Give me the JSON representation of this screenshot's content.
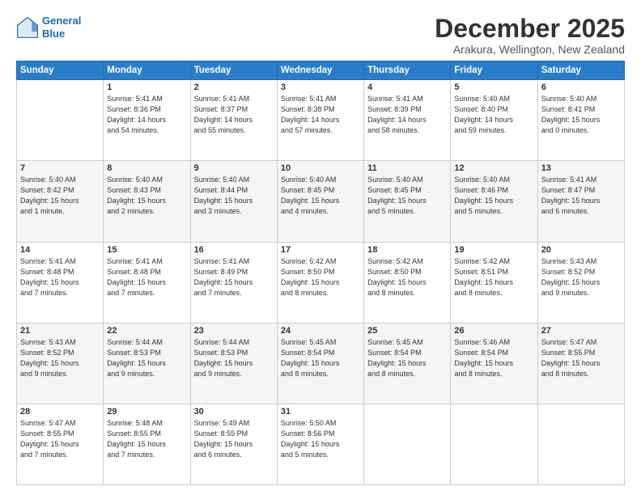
{
  "logo": {
    "line1": "General",
    "line2": "Blue"
  },
  "title": "December 2025",
  "subtitle": "Arakura, Wellington, New Zealand",
  "days_header": [
    "Sunday",
    "Monday",
    "Tuesday",
    "Wednesday",
    "Thursday",
    "Friday",
    "Saturday"
  ],
  "weeks": [
    [
      {
        "day": "",
        "info": ""
      },
      {
        "day": "1",
        "info": "Sunrise: 5:41 AM\nSunset: 8:36 PM\nDaylight: 14 hours\nand 54 minutes."
      },
      {
        "day": "2",
        "info": "Sunrise: 5:41 AM\nSunset: 8:37 PM\nDaylight: 14 hours\nand 55 minutes."
      },
      {
        "day": "3",
        "info": "Sunrise: 5:41 AM\nSunset: 8:38 PM\nDaylight: 14 hours\nand 57 minutes."
      },
      {
        "day": "4",
        "info": "Sunrise: 5:41 AM\nSunset: 8:39 PM\nDaylight: 14 hours\nand 58 minutes."
      },
      {
        "day": "5",
        "info": "Sunrise: 5:40 AM\nSunset: 8:40 PM\nDaylight: 14 hours\nand 59 minutes."
      },
      {
        "day": "6",
        "info": "Sunrise: 5:40 AM\nSunset: 8:41 PM\nDaylight: 15 hours\nand 0 minutes."
      }
    ],
    [
      {
        "day": "7",
        "info": "Sunrise: 5:40 AM\nSunset: 8:42 PM\nDaylight: 15 hours\nand 1 minute."
      },
      {
        "day": "8",
        "info": "Sunrise: 5:40 AM\nSunset: 8:43 PM\nDaylight: 15 hours\nand 2 minutes."
      },
      {
        "day": "9",
        "info": "Sunrise: 5:40 AM\nSunset: 8:44 PM\nDaylight: 15 hours\nand 3 minutes."
      },
      {
        "day": "10",
        "info": "Sunrise: 5:40 AM\nSunset: 8:45 PM\nDaylight: 15 hours\nand 4 minutes."
      },
      {
        "day": "11",
        "info": "Sunrise: 5:40 AM\nSunset: 8:45 PM\nDaylight: 15 hours\nand 5 minutes."
      },
      {
        "day": "12",
        "info": "Sunrise: 5:40 AM\nSunset: 8:46 PM\nDaylight: 15 hours\nand 5 minutes."
      },
      {
        "day": "13",
        "info": "Sunrise: 5:41 AM\nSunset: 8:47 PM\nDaylight: 15 hours\nand 6 minutes."
      }
    ],
    [
      {
        "day": "14",
        "info": "Sunrise: 5:41 AM\nSunset: 8:48 PM\nDaylight: 15 hours\nand 7 minutes."
      },
      {
        "day": "15",
        "info": "Sunrise: 5:41 AM\nSunset: 8:48 PM\nDaylight: 15 hours\nand 7 minutes."
      },
      {
        "day": "16",
        "info": "Sunrise: 5:41 AM\nSunset: 8:49 PM\nDaylight: 15 hours\nand 7 minutes."
      },
      {
        "day": "17",
        "info": "Sunrise: 5:42 AM\nSunset: 8:50 PM\nDaylight: 15 hours\nand 8 minutes."
      },
      {
        "day": "18",
        "info": "Sunrise: 5:42 AM\nSunset: 8:50 PM\nDaylight: 15 hours\nand 8 minutes."
      },
      {
        "day": "19",
        "info": "Sunrise: 5:42 AM\nSunset: 8:51 PM\nDaylight: 15 hours\nand 8 minutes."
      },
      {
        "day": "20",
        "info": "Sunrise: 5:43 AM\nSunset: 8:52 PM\nDaylight: 15 hours\nand 9 minutes."
      }
    ],
    [
      {
        "day": "21",
        "info": "Sunrise: 5:43 AM\nSunset: 8:52 PM\nDaylight: 15 hours\nand 9 minutes."
      },
      {
        "day": "22",
        "info": "Sunrise: 5:44 AM\nSunset: 8:53 PM\nDaylight: 15 hours\nand 9 minutes."
      },
      {
        "day": "23",
        "info": "Sunrise: 5:44 AM\nSunset: 8:53 PM\nDaylight: 15 hours\nand 9 minutes."
      },
      {
        "day": "24",
        "info": "Sunrise: 5:45 AM\nSunset: 8:54 PM\nDaylight: 15 hours\nand 8 minutes."
      },
      {
        "day": "25",
        "info": "Sunrise: 5:45 AM\nSunset: 8:54 PM\nDaylight: 15 hours\nand 8 minutes."
      },
      {
        "day": "26",
        "info": "Sunrise: 5:46 AM\nSunset: 8:54 PM\nDaylight: 15 hours\nand 8 minutes."
      },
      {
        "day": "27",
        "info": "Sunrise: 5:47 AM\nSunset: 8:55 PM\nDaylight: 15 hours\nand 8 minutes."
      }
    ],
    [
      {
        "day": "28",
        "info": "Sunrise: 5:47 AM\nSunset: 8:55 PM\nDaylight: 15 hours\nand 7 minutes."
      },
      {
        "day": "29",
        "info": "Sunrise: 5:48 AM\nSunset: 8:55 PM\nDaylight: 15 hours\nand 7 minutes."
      },
      {
        "day": "30",
        "info": "Sunrise: 5:49 AM\nSunset: 8:55 PM\nDaylight: 15 hours\nand 6 minutes."
      },
      {
        "day": "31",
        "info": "Sunrise: 5:50 AM\nSunset: 8:56 PM\nDaylight: 15 hours\nand 5 minutes."
      },
      {
        "day": "",
        "info": ""
      },
      {
        "day": "",
        "info": ""
      },
      {
        "day": "",
        "info": ""
      }
    ]
  ]
}
